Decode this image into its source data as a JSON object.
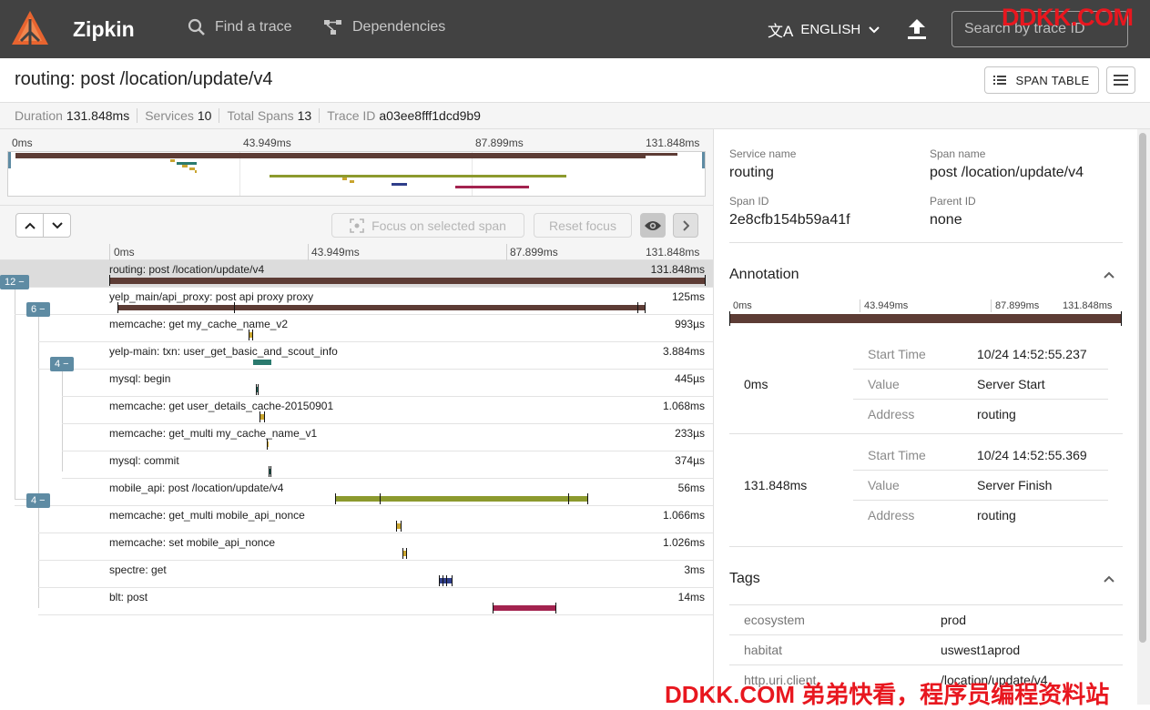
{
  "app": {
    "brand": "Zipkin",
    "nav": {
      "find": "Find a trace",
      "deps": "Dependencies"
    },
    "language": "ENGLISH",
    "search_placeholder": "Search by trace ID",
    "watermark_top": "DDKK.COM"
  },
  "header": {
    "title": "routing: post /location/update/v4",
    "span_table_label": "SPAN TABLE"
  },
  "summary": {
    "duration_label": "Duration",
    "duration": "131.848ms",
    "services_label": "Services",
    "services": "10",
    "spans_label": "Total Spans",
    "spans": "13",
    "traceid_label": "Trace ID",
    "traceid": "a03ee8fff1dcd9b9"
  },
  "timeline": {
    "ticks": [
      "0ms",
      "43.949ms",
      "87.899ms",
      "131.848ms"
    ],
    "focus_label": "Focus on selected span",
    "reset_label": "Reset focus"
  },
  "spans": [
    {
      "name": "routing: post /location/update/v4",
      "duration": "131.848ms",
      "color": "#5d3c35",
      "badge": "12 −"
    },
    {
      "name": "yelp_main/api_proxy: post api proxy proxy",
      "duration": "125ms",
      "color": "#5d3c35",
      "badge": "6 −"
    },
    {
      "name": "memcache: get my_cache_name_v2",
      "duration": "993µs",
      "color": "#c9a52f",
      "badge": ""
    },
    {
      "name": "yelp-main: txn: user_get_basic_and_scout_info",
      "duration": "3.884ms",
      "color": "#2a7a6e",
      "badge": "4 −"
    },
    {
      "name": "mysql: begin",
      "duration": "445µs",
      "color": "#2a7a6e",
      "badge": ""
    },
    {
      "name": "memcache: get user_details_cache-20150901",
      "duration": "1.068ms",
      "color": "#c9a52f",
      "badge": ""
    },
    {
      "name": "memcache: get_multi my_cache_name_v1",
      "duration": "233µs",
      "color": "#c9a52f",
      "badge": ""
    },
    {
      "name": "mysql: commit",
      "duration": "374µs",
      "color": "#2a7a6e",
      "badge": ""
    },
    {
      "name": "mobile_api: post /location/update/v4",
      "duration": "56ms",
      "color": "#8c9a2e",
      "badge": "4 −"
    },
    {
      "name": "memcache: get_multi mobile_api_nonce",
      "duration": "1.066ms",
      "color": "#c9a52f",
      "badge": ""
    },
    {
      "name": "memcache: set mobile_api_nonce",
      "duration": "1.026ms",
      "color": "#c9a52f",
      "badge": ""
    },
    {
      "name": "spectre: get",
      "duration": "3ms",
      "color": "#2f3e8a",
      "badge": ""
    },
    {
      "name": "blt: post",
      "duration": "14ms",
      "color": "#a3234f",
      "badge": ""
    }
  ],
  "detail": {
    "service_name_label": "Service name",
    "service_name": "routing",
    "span_name_label": "Span name",
    "span_name": "post /location/update/v4",
    "span_id_label": "Span ID",
    "span_id": "2e8cfb154b59a41f",
    "parent_id_label": "Parent ID",
    "parent_id": "none",
    "annotation_title": "Annotation",
    "ann_ticks": [
      "0ms",
      "43.949ms",
      "87.899ms",
      "131.848ms"
    ],
    "annotations": [
      {
        "time": "0ms",
        "start_label": "Start Time",
        "start": "10/24 14:52:55.237",
        "value_label": "Value",
        "value": "Server Start",
        "address_label": "Address",
        "address": "routing"
      },
      {
        "time": "131.848ms",
        "start_label": "Start Time",
        "start": "10/24 14:52:55.369",
        "value_label": "Value",
        "value": "Server Finish",
        "address_label": "Address",
        "address": "routing"
      }
    ],
    "tags_title": "Tags",
    "tags": [
      {
        "key": "ecosystem",
        "value": "prod"
      },
      {
        "key": "habitat",
        "value": "uswest1aprod"
      },
      {
        "key": "http.uri.client",
        "value": "/location/update/v4"
      }
    ]
  },
  "watermark_bottom": "DDKK.COM 弟弟快看，程序员编程资料站"
}
